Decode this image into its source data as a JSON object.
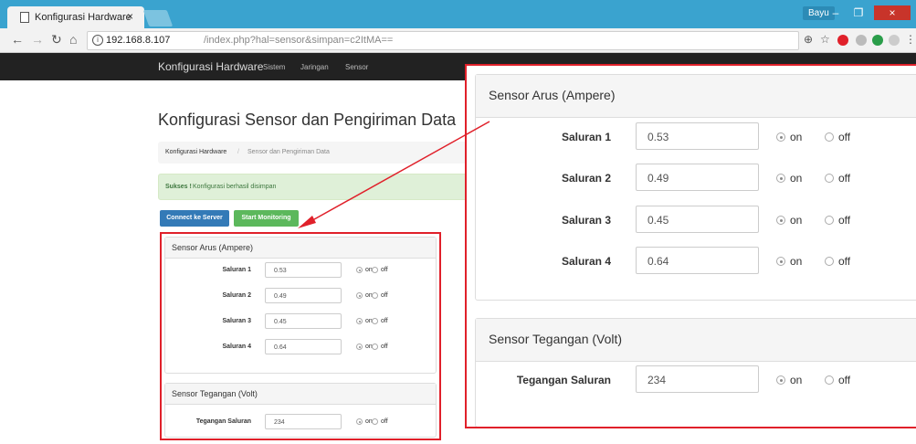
{
  "browser": {
    "tab_title": "Konfigurasi Hardware",
    "tab_close": "×",
    "user_badge": "Bayu",
    "url_host": "192.168.8.107",
    "url_path": "/index.php?hal=sensor&simpan=c2ItMA==",
    "window": {
      "minimize": "–",
      "maximize": "❐",
      "close": "×"
    }
  },
  "navbar": {
    "brand": "Konfigurasi Hardware",
    "links": [
      "Sistem",
      "Jaringan",
      "Sensor"
    ]
  },
  "page": {
    "title": "Konfigurasi Sensor dan Pengiriman Data",
    "breadcrumb": {
      "home": "Konfigurasi Hardware",
      "separator": "/",
      "current": "Sensor dan Pengiriman Data"
    },
    "alert": {
      "strong": "Sukses !",
      "text": "Konfigurasi berhasil disimpan"
    },
    "buttons": {
      "connect": "Connect ke Server",
      "monitor": "Start Monitoring"
    }
  },
  "sensor_arus": {
    "heading": "Sensor Arus (Ampere)",
    "rows": [
      {
        "label": "Saluran 1",
        "value": "0.53",
        "on": "on",
        "off": "off"
      },
      {
        "label": "Saluran 2",
        "value": "0.49",
        "on": "on",
        "off": "off"
      },
      {
        "label": "Saluran 3",
        "value": "0.45",
        "on": "on",
        "off": "off"
      },
      {
        "label": "Saluran 4",
        "value": "0.64",
        "on": "on",
        "off": "off"
      }
    ]
  },
  "sensor_tegangan": {
    "heading": "Sensor Tegangan (Volt)",
    "rows": [
      {
        "label": "Tegangan Saluran",
        "value": "234",
        "on": "on",
        "off": "off"
      }
    ]
  },
  "colors": {
    "highlight": "#e0202a",
    "primary": "#337ab7",
    "success": "#5cb85c"
  }
}
